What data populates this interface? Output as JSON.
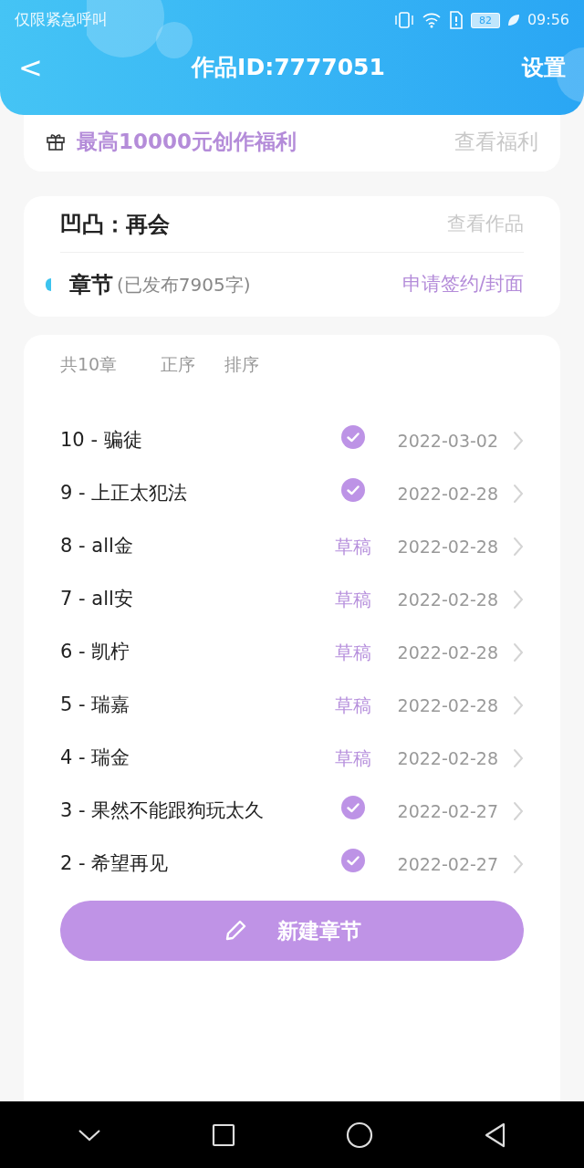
{
  "status_bar": {
    "carrier": "仅限紧急呼叫",
    "battery": "82",
    "time": "09:56"
  },
  "header": {
    "back": "<",
    "title": "作品ID:7777051",
    "settings": "设置"
  },
  "benefit": {
    "text": "最高10000元创作福利",
    "link": "查看福利"
  },
  "work": {
    "title": "凹凸：再会",
    "link": "查看作品",
    "chapters_label": "章节",
    "published_info": "(已发布7905字)",
    "apply_link": "申请签约/封面"
  },
  "list_header": {
    "count": "共10章",
    "order": "正序",
    "sort": "排序"
  },
  "chapters": [
    {
      "title": "10 - 骗徒",
      "kind": "published",
      "date": "2022-03-02"
    },
    {
      "title": "9 - 上正太犯法",
      "kind": "published",
      "date": "2022-02-28"
    },
    {
      "title": "8 - all金",
      "kind": "draft",
      "status": "草稿",
      "date": "2022-02-28"
    },
    {
      "title": "7 - all安",
      "kind": "draft",
      "status": "草稿",
      "date": "2022-02-28"
    },
    {
      "title": "6 - 凯柠",
      "kind": "draft",
      "status": "草稿",
      "date": "2022-02-28"
    },
    {
      "title": "5 - 瑞嘉",
      "kind": "draft",
      "status": "草稿",
      "date": "2022-02-28"
    },
    {
      "title": "4 - 瑞金",
      "kind": "draft",
      "status": "草稿",
      "date": "2022-02-28"
    },
    {
      "title": "3 - 果然不能跟狗玩太久",
      "kind": "published",
      "date": "2022-02-27"
    },
    {
      "title": "2 - 希望再见",
      "kind": "published",
      "date": "2022-02-27"
    }
  ],
  "new_chapter_button": "新建章节"
}
